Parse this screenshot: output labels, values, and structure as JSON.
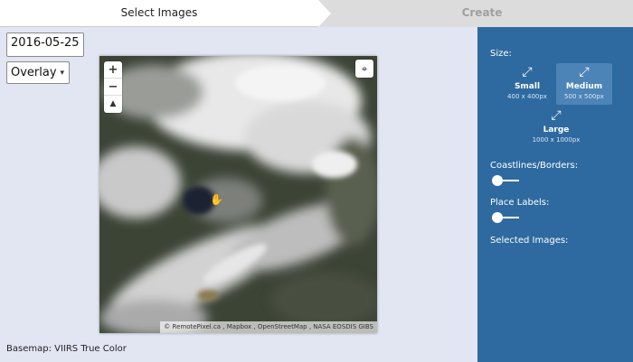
{
  "steps": {
    "active_label": "Select Images",
    "next_label": "Create"
  },
  "controls": {
    "date_value": "2016-05-25",
    "layer_selected": "Overlay"
  },
  "map": {
    "attribution": "© RemotePixel.ca , Mapbox , OpenStreetMap , NASA EOSDIS GIBS",
    "zoom_in": "+",
    "zoom_out": "−",
    "compass": "▲",
    "recenter_icon": "⌖"
  },
  "basemap": {
    "label": "Basemap: VIIRS True Color"
  },
  "panel": {
    "size_heading": "Size:",
    "sizes": [
      {
        "name": "Small",
        "dims": "400 x 400px",
        "selected": false
      },
      {
        "name": "Medium",
        "dims": "500 x 500px",
        "selected": true
      },
      {
        "name": "Large",
        "dims": "1000 x 1000px",
        "selected": false
      }
    ],
    "coastlines_heading": "Coastlines/Borders:",
    "coastlines_on": false,
    "labels_heading": "Place Labels:",
    "labels_on": false,
    "selected_heading": "Selected Images:"
  },
  "colors": {
    "panel_bg": "#2e6aa0",
    "selected_size_bg": "#4c84b7",
    "page_bg": "#e2e6f3"
  }
}
